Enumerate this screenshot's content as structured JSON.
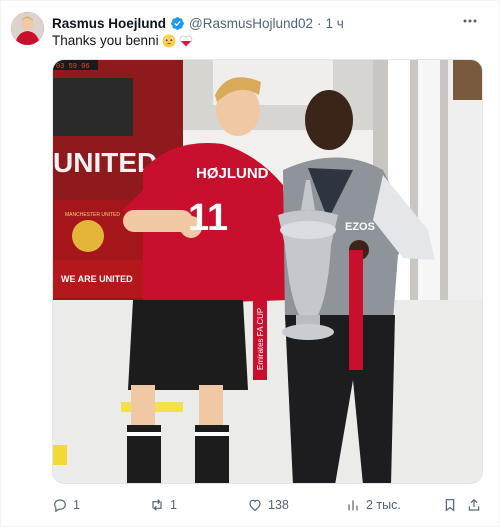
{
  "post": {
    "author_name": "Rasmus Hoejlund",
    "author_handle": "@RasmusHojlund02",
    "separator": "·",
    "time": "1 ч",
    "text": "Thanks you benni",
    "emojis": [
      "pleading-face",
      "poland-flag-heart"
    ]
  },
  "photo": {
    "scoreboard_text": "03 59 06",
    "wall_text": "UNITED",
    "sign_text": "WE ARE UNITED",
    "crest_text": "MANCHESTER UNITED",
    "jersey_name": "HØJLUND",
    "jersey_number": "11",
    "sponsor_text": "EZOS",
    "ribbon_text": "Emirates FA CUP"
  },
  "actions": {
    "replies": "1",
    "reposts": "1",
    "likes": "138",
    "views": "2 тыс."
  },
  "colors": {
    "verified": "#1d9bf0",
    "text_secondary": "#536471",
    "jersey_red": "#c8102e"
  }
}
